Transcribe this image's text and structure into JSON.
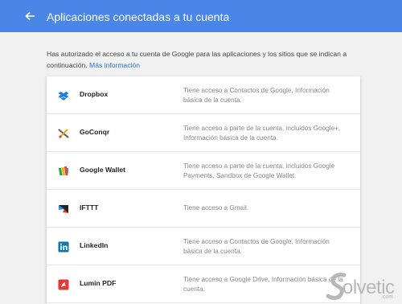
{
  "header": {
    "title": "Aplicaciones conectadas a tu cuenta",
    "back_icon": "arrow-back-icon"
  },
  "intro": {
    "text": "Has autorizado el acceso a tu cuenta de Google para las aplicaciones y los sitios que se indican a continuación.",
    "link": "Más información"
  },
  "apps": [
    {
      "name": "Dropbox",
      "icon": "dropbox-icon",
      "desc": "Tiene acceso a Contactos de Google, Información básica de la cuenta."
    },
    {
      "name": "GoConqr",
      "icon": "goconqr-icon",
      "desc": "Tiene acceso a parte de la cuenta, incluidos Google+, Información básica de la cuenta."
    },
    {
      "name": "Google Wallet",
      "icon": "google-wallet-icon",
      "desc": "Tiene acceso a parte de la cuenta, incluidos Google Payments, Sandbox de Google Wallet."
    },
    {
      "name": "IFTTT",
      "icon": "ifttt-icon",
      "desc": "Tiene acceso a Gmail."
    },
    {
      "name": "LinkedIn",
      "icon": "linkedin-icon",
      "desc": "Tiene acceso a Contactos de Google, Información básica de la cuenta."
    },
    {
      "name": "Lumin PDF",
      "icon": "lumin-pdf-icon",
      "desc": "Tiene acceso a Google Drive, Información básica de la cuenta."
    }
  ],
  "watermark": {
    "text": "olvetic",
    "sub": ".com"
  },
  "colors": {
    "topbar": "#4a86e8",
    "link": "#2a6fd6"
  }
}
